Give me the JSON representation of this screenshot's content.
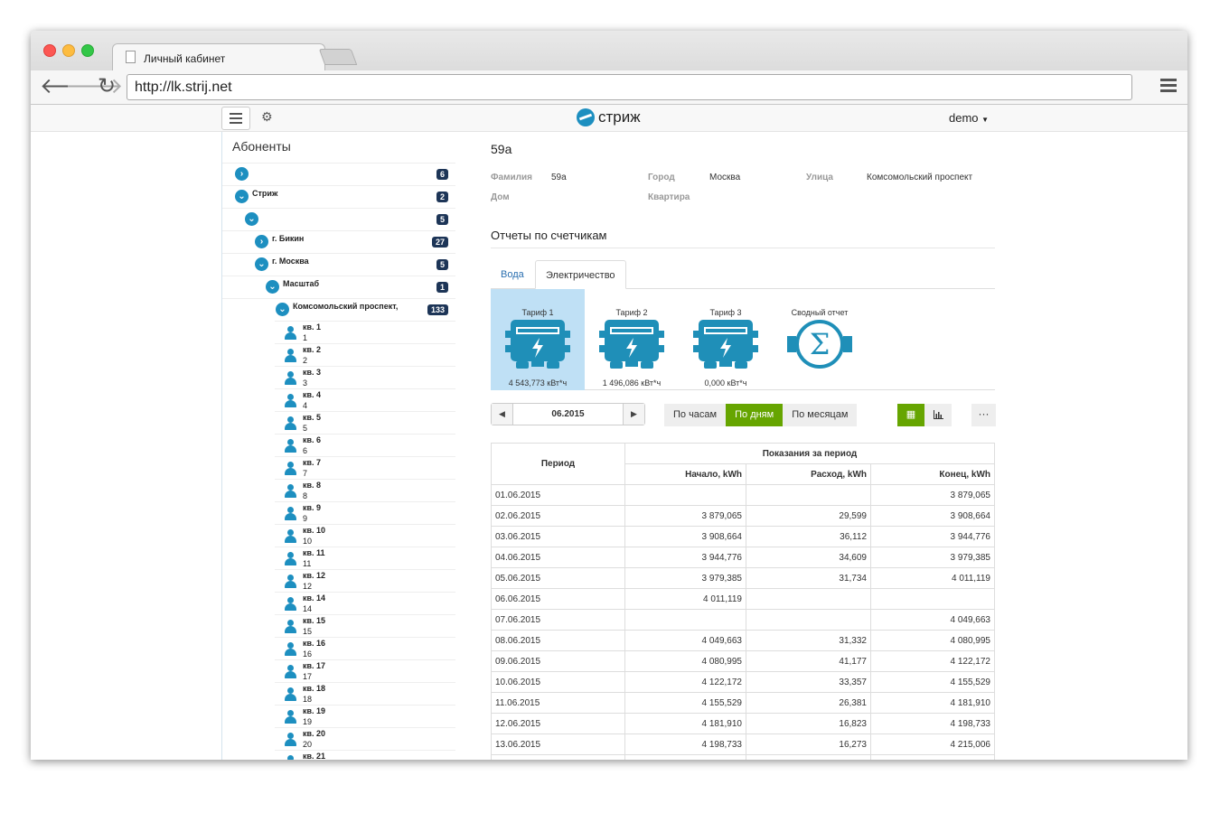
{
  "browser": {
    "tab_title": "Личный кабинет",
    "url": "http://lk.strij.net"
  },
  "app": {
    "brand": "стриж",
    "user": "demo"
  },
  "sidebar": {
    "title": "Абоненты",
    "tree": [
      {
        "label": "",
        "count": "6",
        "state": "collapsed"
      },
      {
        "label": "Стриж",
        "count": "2",
        "state": "expanded"
      },
      {
        "label": "",
        "count": "5",
        "state": "expanded"
      },
      {
        "label": "г. Бикин",
        "count": "27",
        "state": "collapsed"
      },
      {
        "label": "г. Москва",
        "count": "5",
        "state": "expanded"
      },
      {
        "label": "Масштаб",
        "count": "1",
        "state": "expanded"
      },
      {
        "label": "Комсомольский проспект,",
        "count": "133",
        "state": "expanded"
      }
    ],
    "leaves": [
      {
        "name": "кв. 1",
        "num": "1"
      },
      {
        "name": "кв. 2",
        "num": "2"
      },
      {
        "name": "кв. 3",
        "num": "3"
      },
      {
        "name": "кв. 4",
        "num": "4"
      },
      {
        "name": "кв. 5",
        "num": "5"
      },
      {
        "name": "кв. 6",
        "num": "6"
      },
      {
        "name": "кв. 7",
        "num": "7"
      },
      {
        "name": "кв. 8",
        "num": "8"
      },
      {
        "name": "кв. 9",
        "num": "9"
      },
      {
        "name": "кв. 10",
        "num": "10"
      },
      {
        "name": "кв. 11",
        "num": "11"
      },
      {
        "name": "кв. 12",
        "num": "12"
      },
      {
        "name": "кв. 14",
        "num": "14"
      },
      {
        "name": "кв. 15",
        "num": "15"
      },
      {
        "name": "кв. 16",
        "num": "16"
      },
      {
        "name": "кв. 17",
        "num": "17"
      },
      {
        "name": "кв. 18",
        "num": "18"
      },
      {
        "name": "кв. 19",
        "num": "19"
      },
      {
        "name": "кв. 20",
        "num": "20"
      },
      {
        "name": "кв. 21",
        "num": ""
      }
    ]
  },
  "subscriber": {
    "title": "59а",
    "fields": {
      "surname_label": "Фамилия",
      "surname": "59а",
      "city_label": "Город",
      "city": "Москва",
      "street_label": "Улица",
      "street": "Комсомольский проспект",
      "house_label": "Дом",
      "house": "",
      "apartment_label": "Квартира",
      "apartment": ""
    }
  },
  "reports": {
    "title": "Отчеты по счетчикам",
    "tabs": [
      "Вода",
      "Электричество"
    ],
    "active_tab": "Электричество",
    "tiles": [
      {
        "label": "Тариф 1",
        "value": "4 543,773 кВт*ч",
        "icon": "electric-meter-icon",
        "active": true
      },
      {
        "label": "Тариф 2",
        "value": "1 496,086 кВт*ч",
        "icon": "electric-meter-icon",
        "active": false
      },
      {
        "label": "Тариф 3",
        "value": "0,000 кВт*ч",
        "icon": "electric-meter-icon",
        "active": false
      },
      {
        "label": "Сводный отчет",
        "value": "",
        "icon": "sum-meter-icon",
        "active": false
      }
    ],
    "date": "06.2015",
    "period_buttons": [
      "По часам",
      "По дням",
      "По месяцам"
    ],
    "period_selected": "По дням",
    "more_label": "···"
  },
  "table": {
    "col_period": "Период",
    "group_header": "Показания за период",
    "col_start": "Начало, kWh",
    "col_usage": "Расход, kWh",
    "col_end": "Конец, kWh",
    "rows": [
      [
        "01.06.2015",
        "",
        "",
        "3 879,065"
      ],
      [
        "02.06.2015",
        "3 879,065",
        "29,599",
        "3 908,664"
      ],
      [
        "03.06.2015",
        "3 908,664",
        "36,112",
        "3 944,776"
      ],
      [
        "04.06.2015",
        "3 944,776",
        "34,609",
        "3 979,385"
      ],
      [
        "05.06.2015",
        "3 979,385",
        "31,734",
        "4 011,119"
      ],
      [
        "06.06.2015",
        "4 011,119",
        "",
        ""
      ],
      [
        "07.06.2015",
        "",
        "",
        "4 049,663"
      ],
      [
        "08.06.2015",
        "4 049,663",
        "31,332",
        "4 080,995"
      ],
      [
        "09.06.2015",
        "4 080,995",
        "41,177",
        "4 122,172"
      ],
      [
        "10.06.2015",
        "4 122,172",
        "33,357",
        "4 155,529"
      ],
      [
        "11.06.2015",
        "4 155,529",
        "26,381",
        "4 181,910"
      ],
      [
        "12.06.2015",
        "4 181,910",
        "16,823",
        "4 198,733"
      ],
      [
        "13.06.2015",
        "4 198,733",
        "16,273",
        "4 215,006"
      ],
      [
        "",
        "",
        "",
        ""
      ]
    ]
  },
  "colors": {
    "accent": "#1d8fc0",
    "active_green": "#66a500",
    "badge": "#1d3557",
    "tile_active": "#bfe0f5"
  }
}
